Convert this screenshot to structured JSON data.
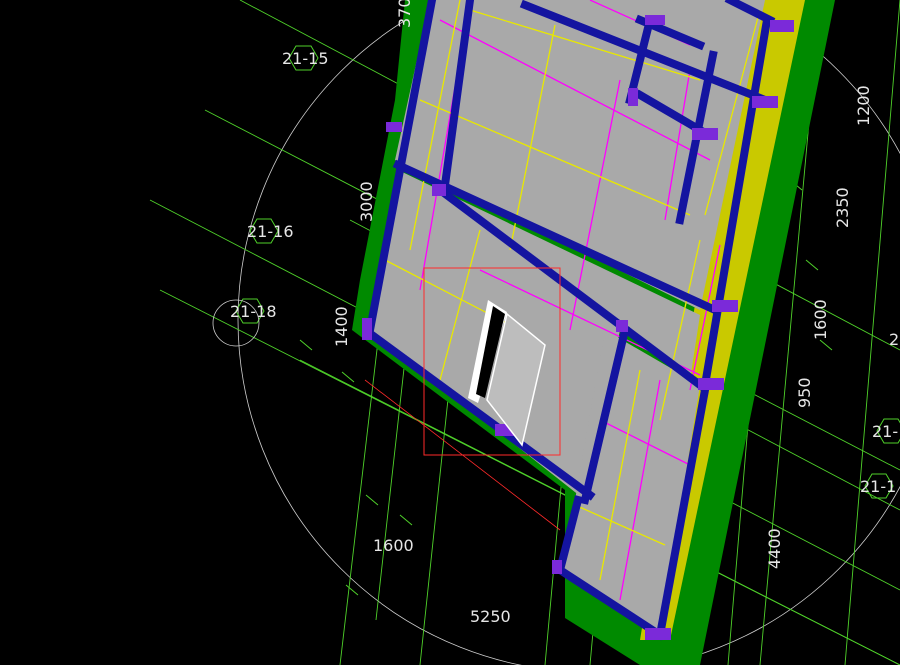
{
  "viewport": {
    "background": "#000000",
    "grid_color": "#4fd12a",
    "selection_color": "#ff2a2a",
    "panel_color": "#a9a9a9",
    "frame_color": "#1414a0",
    "slab_edge_color": "#008a00",
    "yellow_line_color": "#e8e800",
    "magenta_line_color": "#ff00ff",
    "connector_color": "#7b2ad9"
  },
  "grid_labels": {
    "g_21_15": "21-15",
    "g_21_16": "21-16",
    "g_21_18": "21-18",
    "g_21_right": "21-",
    "g_21_1": "21-1",
    "g_2": "2"
  },
  "dimensions": {
    "d_370": "370",
    "d_3000": "3000",
    "d_1400": "1400",
    "d_1600_bottom": "1600",
    "d_5250": "5250",
    "d_1200": "1200",
    "d_2350": "2350",
    "d_1600_right": "1600",
    "d_950": "950",
    "d_4400": "4400"
  }
}
